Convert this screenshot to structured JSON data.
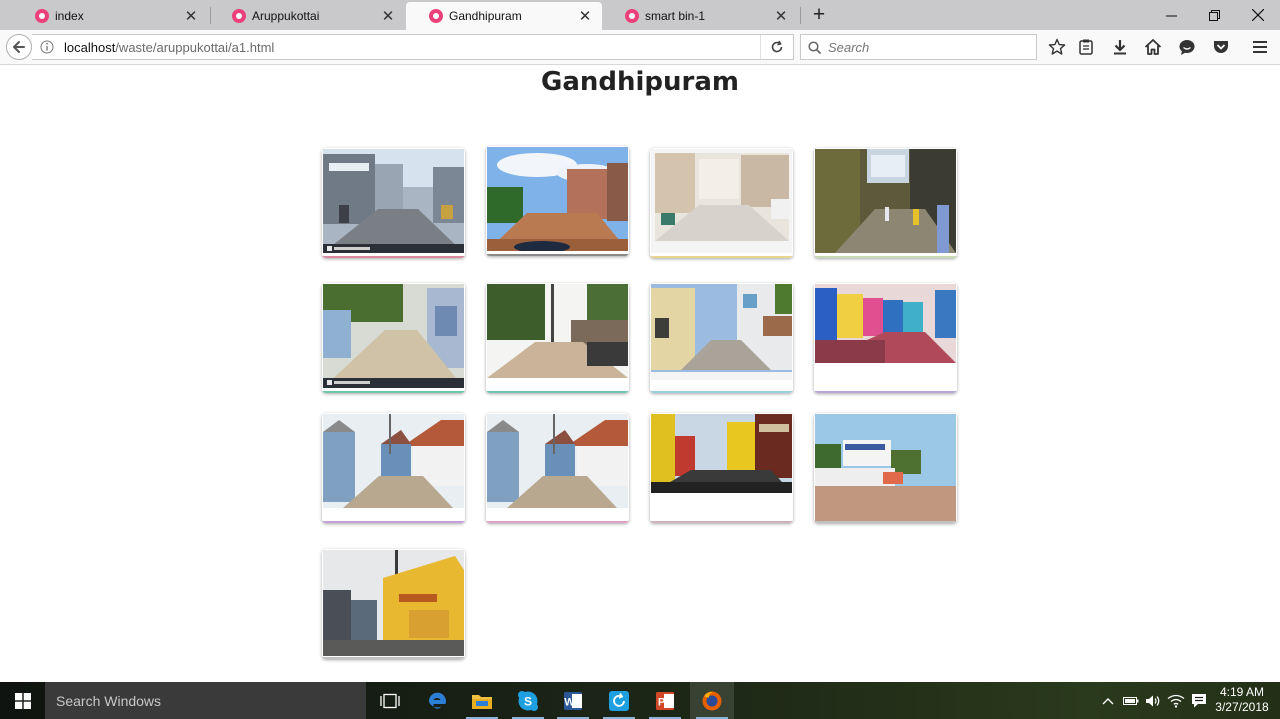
{
  "browser": {
    "tabs": [
      {
        "title": "index",
        "active": false
      },
      {
        "title": "Aruppukottai",
        "active": false
      },
      {
        "title": "Gandhipuram",
        "active": true
      },
      {
        "title": "smart bin-1",
        "active": false
      }
    ],
    "url": {
      "host": "localhost",
      "path": "/waste/aruppukottai/a1.html"
    },
    "search_placeholder": "Search"
  },
  "page": {
    "title": "Gandhipuram",
    "gallery": [
      {
        "scene": "street-market-road",
        "accent": "#d88aa0"
      },
      {
        "scene": "dirt-road-blue-sky",
        "accent": "#8a8a8a"
      },
      {
        "scene": "bright-town-street",
        "accent": "#e6d590"
      },
      {
        "scene": "temple-gopuram-street",
        "accent": "#c8d8b0"
      },
      {
        "scene": "narrow-village-lane",
        "accent": "#6fc6a8"
      },
      {
        "scene": "tree-lined-dirt-road",
        "accent": "#6fc6b8"
      },
      {
        "scene": "colonial-houses-lane",
        "accent": "#9ad0e0"
      },
      {
        "scene": "colorful-row-houses",
        "accent": "#b9a8d8"
      },
      {
        "scene": "tiled-roof-cottages",
        "accent": "#c8a0d8"
      },
      {
        "scene": "tiled-roof-cottages",
        "accent": "#e0a0c8"
      },
      {
        "scene": "yellow-shop-street",
        "accent": "#d0b0b8"
      },
      {
        "scene": "blue-house-road",
        "accent": "#c0c0c0"
      },
      {
        "scene": "yellow-painted-building",
        "accent": "#c0c0c0"
      }
    ]
  },
  "taskbar": {
    "search_placeholder": "Search Windows",
    "apps": [
      "task-view",
      "edge",
      "file-explorer",
      "skype",
      "word",
      "photos",
      "powerpoint",
      "firefox"
    ],
    "time": "4:19 AM",
    "date": "3/27/2018"
  }
}
